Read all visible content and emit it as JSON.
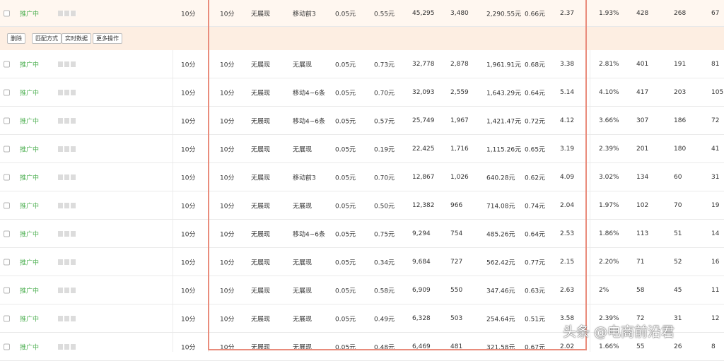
{
  "toolbar": {
    "buttons": [
      "删除",
      "匹配方式",
      "实时数据",
      "更多操作"
    ]
  },
  "rows": [
    {
      "status": "推广中",
      "c1": "10分",
      "c2": "10分",
      "c3": "无展现",
      "c4": "移动前3",
      "c5": "0.05元",
      "c6": "0.55元",
      "c7": "45,295",
      "c8": "3,480",
      "c9": "2,290.55元",
      "c10": "0.66元",
      "c11": "2.37",
      "c12": "1.93%",
      "c13": "428",
      "c14": "268",
      "c15": "67"
    },
    {
      "status": "推广中",
      "c1": "10分",
      "c2": "10分",
      "c3": "无展现",
      "c4": "无展现",
      "c5": "0.05元",
      "c6": "0.73元",
      "c7": "32,778",
      "c8": "2,878",
      "c9": "1,961.91元",
      "c10": "0.68元",
      "c11": "3.38",
      "c12": "2.81%",
      "c13": "401",
      "c14": "191",
      "c15": "81"
    },
    {
      "status": "推广中",
      "c1": "10分",
      "c2": "10分",
      "c3": "无展现",
      "c4": "移动4~6条",
      "c5": "0.05元",
      "c6": "0.70元",
      "c7": "32,093",
      "c8": "2,559",
      "c9": "1,643.29元",
      "c10": "0.64元",
      "c11": "5.14",
      "c12": "4.10%",
      "c13": "417",
      "c14": "203",
      "c15": "105"
    },
    {
      "status": "推广中",
      "c1": "10分",
      "c2": "10分",
      "c3": "无展现",
      "c4": "移动4~6条",
      "c5": "0.05元",
      "c6": "0.57元",
      "c7": "25,749",
      "c8": "1,967",
      "c9": "1,421.47元",
      "c10": "0.72元",
      "c11": "4.12",
      "c12": "3.66%",
      "c13": "307",
      "c14": "186",
      "c15": "72"
    },
    {
      "status": "推广中",
      "c1": "10分",
      "c2": "10分",
      "c3": "无展现",
      "c4": "无展现",
      "c5": "0.05元",
      "c6": "0.19元",
      "c7": "22,425",
      "c8": "1,716",
      "c9": "1,115.26元",
      "c10": "0.65元",
      "c11": "3.19",
      "c12": "2.39%",
      "c13": "201",
      "c14": "180",
      "c15": "41"
    },
    {
      "status": "推广中",
      "c1": "10分",
      "c2": "10分",
      "c3": "无展现",
      "c4": "移动前3",
      "c5": "0.05元",
      "c6": "0.70元",
      "c7": "12,867",
      "c8": "1,026",
      "c9": "640.28元",
      "c10": "0.62元",
      "c11": "4.09",
      "c12": "3.02%",
      "c13": "134",
      "c14": "60",
      "c15": "31"
    },
    {
      "status": "推广中",
      "c1": "10分",
      "c2": "10分",
      "c3": "无展现",
      "c4": "无展现",
      "c5": "0.05元",
      "c6": "0.50元",
      "c7": "12,382",
      "c8": "966",
      "c9": "714.08元",
      "c10": "0.74元",
      "c11": "2.04",
      "c12": "1.97%",
      "c13": "102",
      "c14": "70",
      "c15": "19"
    },
    {
      "status": "推广中",
      "c1": "10分",
      "c2": "10分",
      "c3": "无展现",
      "c4": "移动4~6条",
      "c5": "0.05元",
      "c6": "0.75元",
      "c7": "9,294",
      "c8": "754",
      "c9": "485.26元",
      "c10": "0.64元",
      "c11": "2.53",
      "c12": "1.86%",
      "c13": "113",
      "c14": "51",
      "c15": "14"
    },
    {
      "status": "推广中",
      "c1": "10分",
      "c2": "10分",
      "c3": "无展现",
      "c4": "无展现",
      "c5": "0.05元",
      "c6": "0.34元",
      "c7": "9,684",
      "c8": "727",
      "c9": "562.42元",
      "c10": "0.77元",
      "c11": "2.15",
      "c12": "2.20%",
      "c13": "71",
      "c14": "52",
      "c15": "16"
    },
    {
      "status": "推广中",
      "c1": "10分",
      "c2": "10分",
      "c3": "无展现",
      "c4": "无展现",
      "c5": "0.05元",
      "c6": "0.58元",
      "c7": "6,909",
      "c8": "550",
      "c9": "347.46元",
      "c10": "0.63元",
      "c11": "2.63",
      "c12": "2%",
      "c13": "58",
      "c14": "45",
      "c15": "11"
    },
    {
      "status": "推广中",
      "c1": "10分",
      "c2": "10分",
      "c3": "无展现",
      "c4": "无展现",
      "c5": "0.05元",
      "c6": "0.49元",
      "c7": "6,328",
      "c8": "503",
      "c9": "254.64元",
      "c10": "0.51元",
      "c11": "3.58",
      "c12": "2.39%",
      "c13": "72",
      "c14": "31",
      "c15": "12"
    },
    {
      "status": "推广中",
      "c1": "10分",
      "c2": "10分",
      "c3": "无展现",
      "c4": "无展现",
      "c5": "0.05元",
      "c6": "0.48元",
      "c7": "6,469",
      "c8": "481",
      "c9": "321.58元",
      "c10": "0.67元",
      "c11": "2.02",
      "c12": "1.66%",
      "c13": "55",
      "c14": "26",
      "c15": "8"
    }
  ],
  "watermark": "头条 @电商前沿君",
  "colors": {
    "status": "#4caf50",
    "highlight_box": "#e98c7c",
    "toolbar_bg": "#fdeee2"
  }
}
